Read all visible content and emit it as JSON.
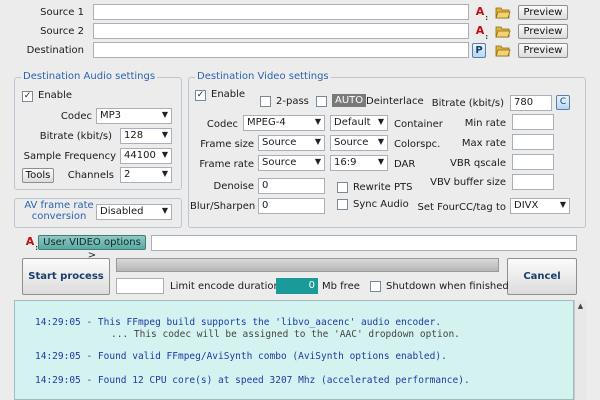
{
  "sources": {
    "source1_label": "Source 1",
    "source2_label": "Source 2",
    "destination_label": "Destination",
    "preview_label": "Preview",
    "p_label": "P",
    "a_label": "A"
  },
  "audio": {
    "title": "Destination Audio settings",
    "enable_label": "Enable",
    "enable_checked": "✓",
    "codec_label": "Codec",
    "codec_value": "MP3",
    "bitrate_label": "Bitrate (kbit/s)",
    "bitrate_value": "128",
    "freq_label": "Sample Frequency",
    "freq_value": "44100",
    "tools_label": "Tools",
    "channels_label": "Channels",
    "channels_value": "2"
  },
  "av": {
    "title": "AV frame rate conversion",
    "title_line1": "AV frame rate",
    "title_line2": "conversion",
    "value": "Disabled"
  },
  "video": {
    "title": "Destination Video settings",
    "enable_label": "Enable",
    "enable_checked": "✓",
    "twopass_label": "2-pass",
    "auto_label": "AUTO",
    "deinterlace_label": "Deinterlace",
    "bitrate_label": "Bitrate (kbit/s)",
    "bitrate_value": "780",
    "c_label": "C",
    "codec_label": "Codec",
    "codec_value": "MPEG-4",
    "codec_default": "Default",
    "container_label": "Container",
    "min_rate_label": "Min rate",
    "framesize_label": "Frame size",
    "framesize_value": "Source",
    "framesize_value2": "Source",
    "colorspc_label": "Colorspc.",
    "max_rate_label": "Max rate",
    "framerate_label": "Frame rate",
    "framerate_value": "Source",
    "dar_value": "16:9",
    "dar_label": "DAR",
    "vbr_label": "VBR qscale",
    "denoise_label": "Denoise",
    "denoise_value": "0",
    "rewrite_label": "Rewrite PTS",
    "vbv_label": "VBV buffer size",
    "blur_label": "Blur/Sharpen",
    "blur_value": "0",
    "sync_label": "Sync Audio",
    "fourcc_label": "Set FourCC/tag to",
    "fourcc_value": "DIVX"
  },
  "user_options": {
    "label": "User VIDEO options >"
  },
  "process": {
    "start_label": "Start process",
    "cancel_label": "Cancel",
    "limit_label": "Limit encode duration",
    "mbfree_value": "0",
    "mbfree_label": "Mb free",
    "shutdown_label": "Shutdown when finished"
  },
  "log": {
    "lines": [
      "14:29:05 - This FFmpeg build supports the 'libvo_aacenc' audio encoder.",
      "... This codec will be assigned to the 'AAC' dropdown option.",
      "14:29:05 - Found valid FFmpeg/AviSynth combo (AviSynth options enabled).",
      "14:29:05 - Found 12 CPU core(s) at speed 3207 Mhz (accelerated performance)."
    ]
  },
  "colors": {
    "group_title": "#2a62b0",
    "log_bg": "#d4f2ef",
    "log_text": "#1e3aa8",
    "mbfree_bg": "#1a9a9a",
    "auto_bg": "#7a7a7a"
  }
}
